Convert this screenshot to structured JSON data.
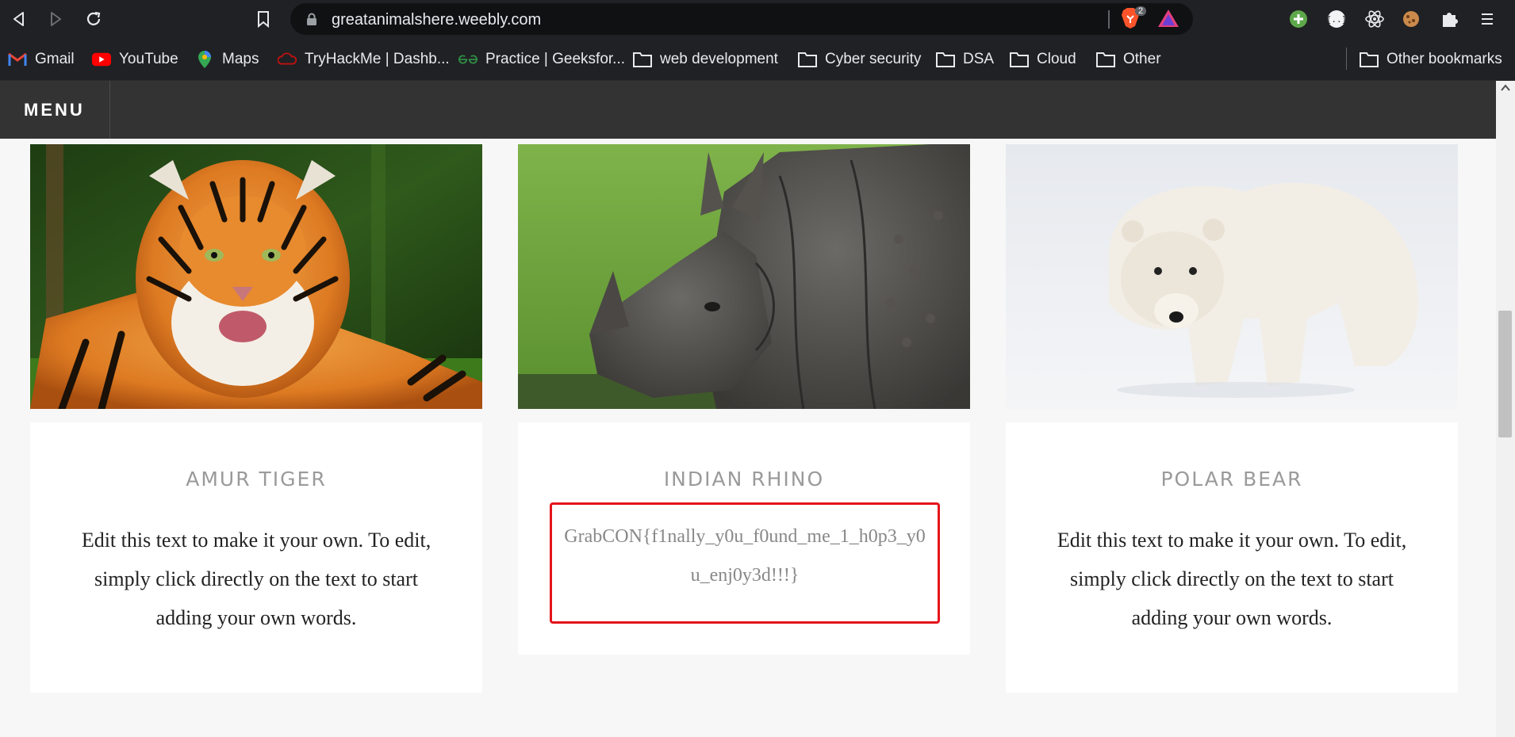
{
  "browser": {
    "url": "greatanimalshere.weebly.com",
    "brave_badge": "2",
    "bookmarks": [
      {
        "label": "Gmail",
        "icon": "gmail-icon"
      },
      {
        "label": "YouTube",
        "icon": "youtube-icon"
      },
      {
        "label": "Maps",
        "icon": "maps-icon"
      },
      {
        "label": "TryHackMe | Dashb...",
        "icon": "tryhackme-icon"
      },
      {
        "label": "Practice | Geeksfor...",
        "icon": "geeksforgeeks-icon"
      },
      {
        "label": "web development",
        "icon": "folder-icon"
      },
      {
        "label": "Cyber security",
        "icon": "folder-icon"
      },
      {
        "label": "DSA",
        "icon": "folder-icon"
      },
      {
        "label": "Cloud",
        "icon": "folder-icon"
      },
      {
        "label": "Other",
        "icon": "folder-icon"
      }
    ],
    "other_bookmarks": "Other bookmarks"
  },
  "site": {
    "menu_label": "MENU",
    "cards": [
      {
        "title": "AMUR TIGER",
        "body": "Edit this text to make it your own. To edit, simply click directly on the text to start adding your own words."
      },
      {
        "title": "INDIAN RHINO",
        "body": "GrabCON{f1nally_y0u_f0und_me_1_h0p3_y0u_enj0y3d!!!}"
      },
      {
        "title": "POLAR BEAR",
        "body": "Edit this text to make it your own. To edit, simply click directly on the text to start adding your own words."
      }
    ]
  },
  "colors": {
    "chrome_bg": "#202124",
    "header_bg": "#333333",
    "highlight_border": "#e5141b"
  }
}
